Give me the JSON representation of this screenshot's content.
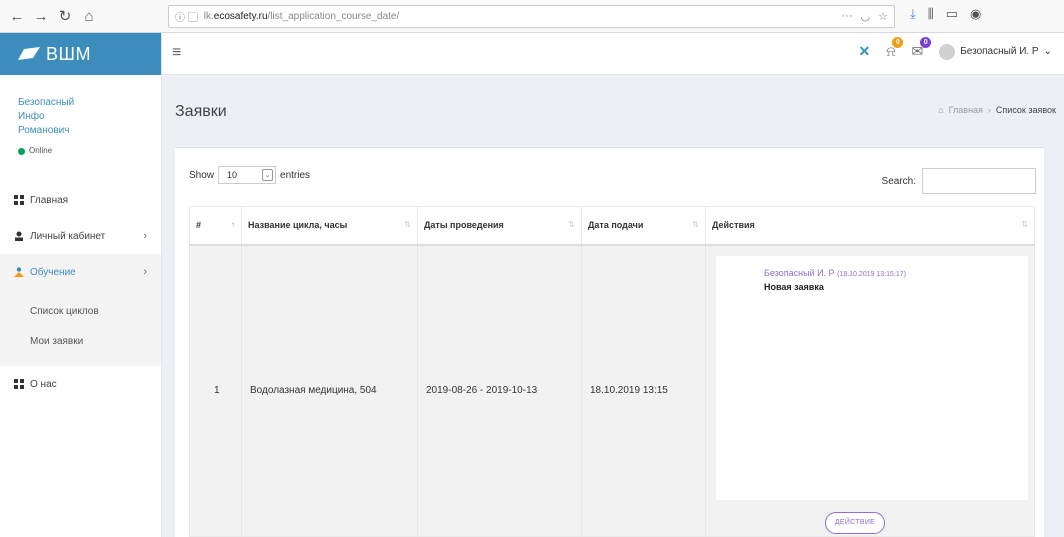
{
  "browser": {
    "url_prefix": "lk.",
    "url_host": "ecosafety.ru",
    "url_path": "/list_application_course_date/",
    "url_more": "···"
  },
  "sidebar": {
    "logo": "ВШМ",
    "user": {
      "first": "Безопасный",
      "middle": "Инфо",
      "last": "Романович",
      "status": "Online"
    },
    "items": [
      {
        "label": "Главная"
      },
      {
        "label": "Личный кабинет",
        "chevron": "›"
      },
      {
        "label": "Обучение",
        "chevron": "›"
      },
      {
        "label": "О нас"
      }
    ],
    "submenu": [
      {
        "label": "Список циклов"
      },
      {
        "label": "Мои заявки"
      }
    ]
  },
  "topbar": {
    "hamburger": "≡",
    "notif_badge": "0",
    "mail_badge": "0",
    "user_name": "Безопасный И. Р",
    "user_chevron": "⌄"
  },
  "page": {
    "title": "Заявки",
    "breadcrumb": {
      "home": "Главная",
      "sep": "›",
      "current": "Список заявок"
    }
  },
  "table": {
    "show_label": "Show",
    "entries_value": "10",
    "entries_label": "entries",
    "search_label": "Search:",
    "columns": [
      "#",
      "Название цикла, часы",
      "Даты проведения",
      "Дата подачи",
      "Действия"
    ],
    "rows": [
      {
        "num": "1",
        "name": "Водолазная медицина, 504",
        "dates": "2019-08-26 - 2019-10-13",
        "submitted": "18.10.2019 13:15",
        "action_author": "Безопасный И. Р",
        "action_time": "(18.10.2019 13:15:17)",
        "action_text": "Новая заявка",
        "action_button": "ДЕЙСТВИЕ"
      }
    ]
  },
  "colors": {
    "brand": "#3c8dbc",
    "accent": "#8e6fcf",
    "online": "#00a65a"
  }
}
